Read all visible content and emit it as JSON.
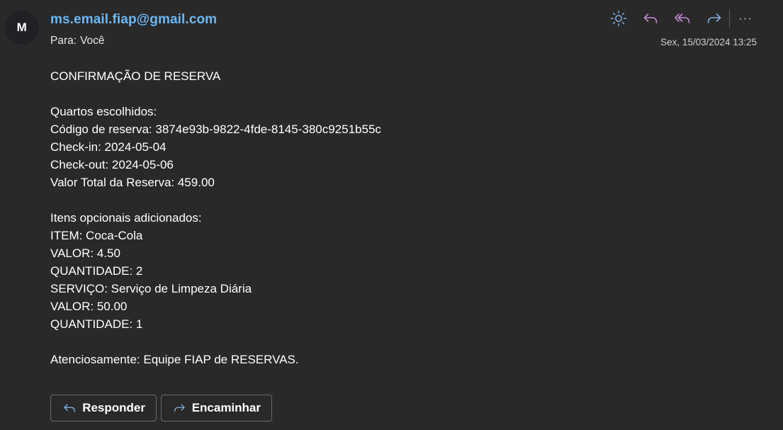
{
  "sender": {
    "initial": "M",
    "email": "ms.email.fiap@gmail.com"
  },
  "recipient": {
    "label": "Para:",
    "value": "Você"
  },
  "datetime": "Sex, 15/03/2024 13:25",
  "toolbar": {
    "icons": [
      "sun-icon",
      "reply-icon",
      "reply-all-icon",
      "forward-icon",
      "more-icon"
    ],
    "more_label": "···",
    "accent_color": "#7fb0e6",
    "reply_color": "#c58ad6"
  },
  "message": {
    "lines": [
      "CONFIRMAÇÃO DE RESERVA",
      "",
      "Quartos escolhidos:",
      "Código de reserva: 3874e93b-9822-4fde-8145-380c9251b55c",
      "Check-in: 2024-05-04",
      "Check-out: 2024-05-06",
      "Valor Total da Reserva: 459.00",
      "",
      "Itens opcionais adicionados:",
      "ITEM: Coca-Cola",
      "VALOR: 4.50",
      "QUANTIDADE: 2",
      "SERVIÇO: Serviço de Limpeza Diária",
      "VALOR: 50.00",
      "QUANTIDADE: 1",
      "",
      "Atenciosamente: Equipe FIAP de RESERVAS."
    ]
  },
  "actions": {
    "reply_label": "Responder",
    "forward_label": "Encaminhar"
  }
}
